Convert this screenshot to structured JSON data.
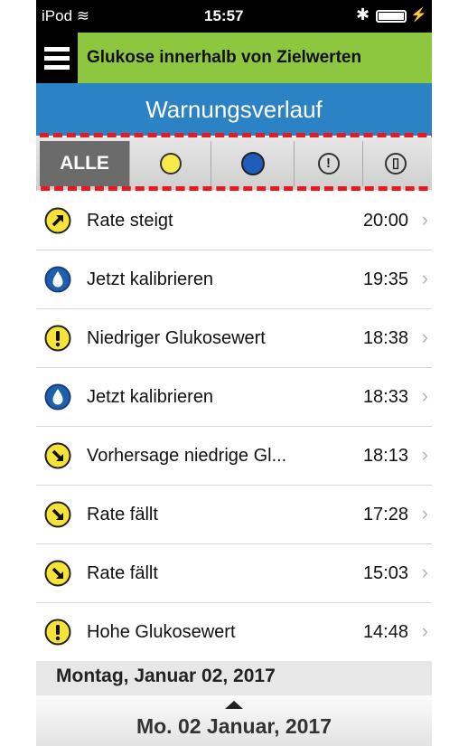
{
  "status_bar": {
    "device": "iPod",
    "time": "15:57"
  },
  "top_bar": {
    "title": "Glukose innerhalb von Zielwerten",
    "accent_color": "#8dc63f"
  },
  "header": {
    "title": "Warnungsverlauf",
    "color": "#2b83c6"
  },
  "filters": [
    {
      "label": "ALLE",
      "icon": "all",
      "selected": true
    },
    {
      "label": "",
      "icon": "yellow-circle-icon",
      "selected": false
    },
    {
      "label": "",
      "icon": "blue-circle-icon",
      "selected": false
    },
    {
      "label": "",
      "icon": "exclamation-circle-icon",
      "selected": false
    },
    {
      "label": "",
      "icon": "battery-circle-icon",
      "selected": false
    }
  ],
  "alerts": [
    {
      "icon": "rate-up-icon",
      "label": "Rate steigt",
      "time": "20:00"
    },
    {
      "icon": "calibrate-drop-icon",
      "label": "Jetzt kalibrieren",
      "time": "19:35"
    },
    {
      "icon": "exclamation-yellow-icon",
      "label": "Niedriger Glukosewert",
      "time": "18:38"
    },
    {
      "icon": "calibrate-drop-icon",
      "label": "Jetzt kalibrieren",
      "time": "18:33"
    },
    {
      "icon": "rate-down-icon",
      "label": "Vorhersage niedrige Gl...",
      "time": "18:13"
    },
    {
      "icon": "rate-down-icon",
      "label": "Rate fällt",
      "time": "17:28"
    },
    {
      "icon": "rate-down-icon",
      "label": "Rate fällt",
      "time": "15:03"
    },
    {
      "icon": "exclamation-yellow-icon",
      "label": "Hohe Glukosewert",
      "time": "14:48"
    }
  ],
  "section_date": "Montag, Januar 02, 2017",
  "date_picker": {
    "value": "Mo. 02 Januar, 2017"
  },
  "chevron": "›"
}
